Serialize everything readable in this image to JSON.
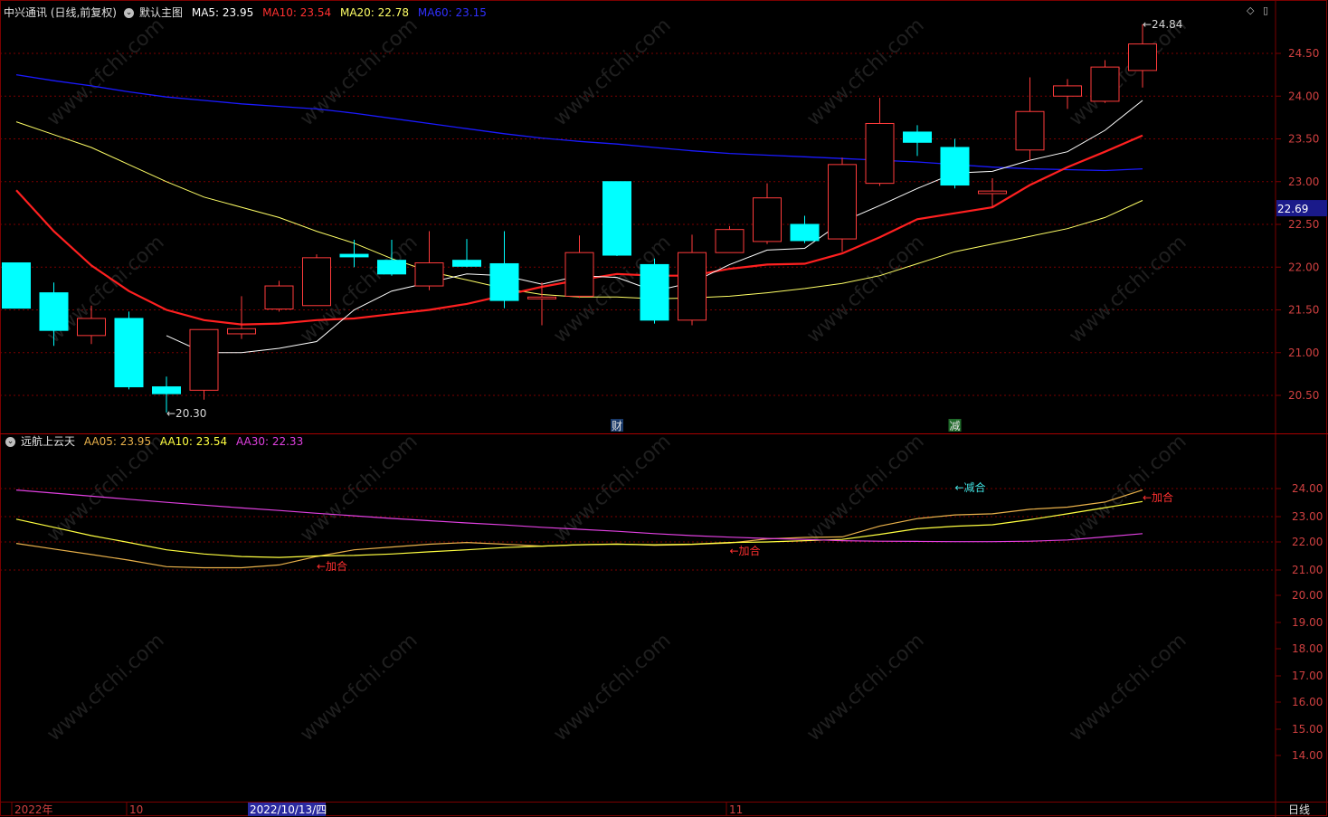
{
  "main_header": {
    "stock": "中兴通讯 (日线,前复权)",
    "template": "默认主图",
    "ma5": "MA5: 23.95",
    "ma10": "MA10: 23.54",
    "ma20": "MA20: 22.78",
    "ma60": "MA60: 23.15"
  },
  "sub_header": {
    "indicator": "远航上云天",
    "aa05": "AA05: 23.95",
    "aa10": "AA10: 23.54",
    "aa30": "AA30: 22.33"
  },
  "colors": {
    "up": "#ff3b3b",
    "down": "#00ffff",
    "ma5": "#ffffff",
    "ma10": "#ff2020",
    "ma20": "#ffff66",
    "ma60": "#1a1aff",
    "aa05": "#e8b04a",
    "aa10": "#ffff40",
    "aa30": "#e040e0",
    "grid": "#7a0000",
    "axis_text": "#d04040",
    "header_text": "#d8d8d8"
  },
  "chart_data": [
    {
      "type": "candlestick",
      "title": "中兴通讯 (日线,前复权)",
      "ylim": [
        20.1,
        25.0
      ],
      "yticks": [
        "24.50",
        "24.00",
        "23.50",
        "23.00",
        "22.50",
        "22.00",
        "21.50",
        "21.00",
        "20.50"
      ],
      "current_price_label": "22.69",
      "candles": [
        {
          "o": 22.05,
          "h": 22.05,
          "l": 21.52,
          "c": 21.52
        },
        {
          "o": 21.7,
          "h": 21.82,
          "l": 21.08,
          "c": 21.26
        },
        {
          "o": 21.2,
          "h": 21.55,
          "l": 21.1,
          "c": 21.4
        },
        {
          "o": 21.4,
          "h": 21.48,
          "l": 20.57,
          "c": 20.6
        },
        {
          "o": 20.6,
          "h": 20.72,
          "l": 20.3,
          "c": 20.52
        },
        {
          "o": 20.56,
          "h": 20.96,
          "l": 20.45,
          "c": 21.27
        },
        {
          "o": 21.22,
          "h": 21.66,
          "l": 21.16,
          "c": 21.28
        },
        {
          "o": 21.51,
          "h": 21.84,
          "l": 21.48,
          "c": 21.78
        },
        {
          "o": 21.55,
          "h": 22.15,
          "l": 21.55,
          "c": 22.11
        },
        {
          "o": 22.15,
          "h": 22.32,
          "l": 22.0,
          "c": 22.12
        },
        {
          "o": 22.08,
          "h": 22.32,
          "l": 21.9,
          "c": 21.92
        },
        {
          "o": 21.78,
          "h": 22.42,
          "l": 21.73,
          "c": 22.05
        },
        {
          "o": 22.08,
          "h": 22.33,
          "l": 22.0,
          "c": 22.01
        },
        {
          "o": 22.04,
          "h": 22.42,
          "l": 21.52,
          "c": 21.61
        },
        {
          "o": 21.65,
          "h": 21.82,
          "l": 21.32,
          "c": 21.65
        },
        {
          "o": 21.66,
          "h": 22.37,
          "l": 21.64,
          "c": 22.17
        },
        {
          "o": 23.0,
          "h": 23.0,
          "l": 22.13,
          "c": 22.14
        },
        {
          "o": 22.03,
          "h": 22.1,
          "l": 21.34,
          "c": 21.38
        },
        {
          "o": 21.38,
          "h": 22.38,
          "l": 21.32,
          "c": 22.17
        },
        {
          "o": 22.17,
          "h": 22.48,
          "l": 22.17,
          "c": 22.44
        },
        {
          "o": 22.3,
          "h": 22.98,
          "l": 22.27,
          "c": 22.81
        },
        {
          "o": 22.5,
          "h": 22.6,
          "l": 22.28,
          "c": 22.31
        },
        {
          "o": 22.33,
          "h": 23.28,
          "l": 22.18,
          "c": 23.2
        },
        {
          "o": 22.98,
          "h": 23.98,
          "l": 22.95,
          "c": 23.68
        },
        {
          "o": 23.58,
          "h": 23.66,
          "l": 23.3,
          "c": 23.46
        },
        {
          "o": 23.4,
          "h": 23.5,
          "l": 22.92,
          "c": 22.96
        },
        {
          "o": 22.86,
          "h": 23.04,
          "l": 22.7,
          "c": 22.89
        },
        {
          "o": 23.37,
          "h": 24.22,
          "l": 23.25,
          "c": 23.82
        },
        {
          "o": 24.0,
          "h": 24.2,
          "l": 23.85,
          "c": 24.12
        },
        {
          "o": 23.94,
          "h": 24.42,
          "l": 23.92,
          "c": 24.34
        },
        {
          "o": 24.3,
          "h": 24.84,
          "l": 24.1,
          "c": 24.61
        }
      ],
      "ma5": [
        null,
        null,
        null,
        null,
        21.2,
        21.0,
        21.0,
        21.05,
        21.13,
        21.5,
        21.72,
        21.82,
        21.92,
        21.9,
        21.8,
        21.9,
        21.88,
        21.72,
        21.82,
        22.03,
        22.2,
        22.22,
        22.53,
        22.72,
        22.92,
        23.1,
        23.12,
        23.25,
        23.35,
        23.6,
        23.95
      ],
      "ma10": [
        22.9,
        22.42,
        22.02,
        21.72,
        21.5,
        21.38,
        21.33,
        21.34,
        21.38,
        21.4,
        21.45,
        21.5,
        21.57,
        21.67,
        21.77,
        21.85,
        21.92,
        21.9,
        21.9,
        21.98,
        22.03,
        22.04,
        22.16,
        22.35,
        22.56,
        22.63,
        22.7,
        22.96,
        23.17,
        23.35,
        23.54
      ],
      "ma20": [
        23.7,
        23.55,
        23.4,
        23.2,
        23.0,
        22.82,
        22.7,
        22.58,
        22.42,
        22.28,
        22.1,
        21.95,
        21.85,
        21.75,
        21.68,
        21.65,
        21.65,
        21.63,
        21.64,
        21.66,
        21.7,
        21.75,
        21.81,
        21.9,
        22.04,
        22.18,
        22.27,
        22.36,
        22.45,
        22.58,
        22.78
      ],
      "ma60": [
        24.25,
        24.18,
        24.12,
        24.05,
        23.99,
        23.95,
        23.91,
        23.88,
        23.85,
        23.8,
        23.74,
        23.68,
        23.62,
        23.56,
        23.51,
        23.47,
        23.44,
        23.4,
        23.36,
        23.33,
        23.31,
        23.29,
        23.27,
        23.25,
        23.23,
        23.2,
        23.17,
        23.15,
        23.14,
        23.13,
        23.15
      ],
      "annotations": [
        {
          "index": 4,
          "text": "←20.30"
        },
        {
          "index": 30,
          "text": "←24.84"
        },
        {
          "index": 16,
          "text": "财"
        },
        {
          "index": 25,
          "text": "减"
        }
      ]
    },
    {
      "type": "line",
      "title": "远航上云天",
      "yticks": [
        "24.00",
        "23.00",
        "22.00",
        "21.00",
        "20.00",
        "19.00",
        "18.00",
        "17.00",
        "16.00",
        "15.00",
        "14.00"
      ],
      "series": [
        {
          "name": "AA05",
          "values": [
            21.95,
            21.75,
            21.55,
            21.35,
            21.12,
            21.08,
            21.08,
            21.18,
            21.48,
            21.72,
            21.82,
            21.92,
            21.98,
            21.92,
            21.85,
            21.9,
            21.93,
            21.88,
            21.91,
            21.96,
            22.12,
            22.18,
            22.2,
            22.63,
            22.92,
            23.06,
            23.1,
            23.26,
            23.34,
            23.52,
            23.95
          ]
        },
        {
          "name": "AA10",
          "values": [
            22.9,
            22.58,
            22.25,
            21.98,
            21.72,
            21.57,
            21.48,
            21.45,
            21.5,
            21.52,
            21.57,
            21.65,
            21.72,
            21.8,
            21.85,
            21.9,
            21.92,
            21.9,
            21.92,
            21.98,
            22.0,
            22.05,
            22.1,
            22.3,
            22.52,
            22.62,
            22.68,
            22.88,
            23.1,
            23.32,
            23.54
          ]
        },
        {
          "name": "AA30",
          "values": [
            23.95,
            23.84,
            23.73,
            23.62,
            23.51,
            23.41,
            23.31,
            23.22,
            23.12,
            23.03,
            22.93,
            22.84,
            22.75,
            22.67,
            22.58,
            22.5,
            22.42,
            22.33,
            22.25,
            22.19,
            22.14,
            22.1,
            22.05,
            22.03,
            22.02,
            22.01,
            22.01,
            22.03,
            22.08,
            22.2,
            22.33
          ]
        }
      ],
      "annotations": [
        {
          "index": 8,
          "text": "←加合"
        },
        {
          "index": 19,
          "text": "←加合"
        },
        {
          "index": 25,
          "text": "←减合"
        },
        {
          "index": 30,
          "text": "←加合"
        }
      ]
    }
  ],
  "x_axis": {
    "labels": [
      "2022年",
      "10",
      "2022/10/13/四",
      "11"
    ],
    "cycle": "日线"
  },
  "watermark": "www.cfchi.com"
}
